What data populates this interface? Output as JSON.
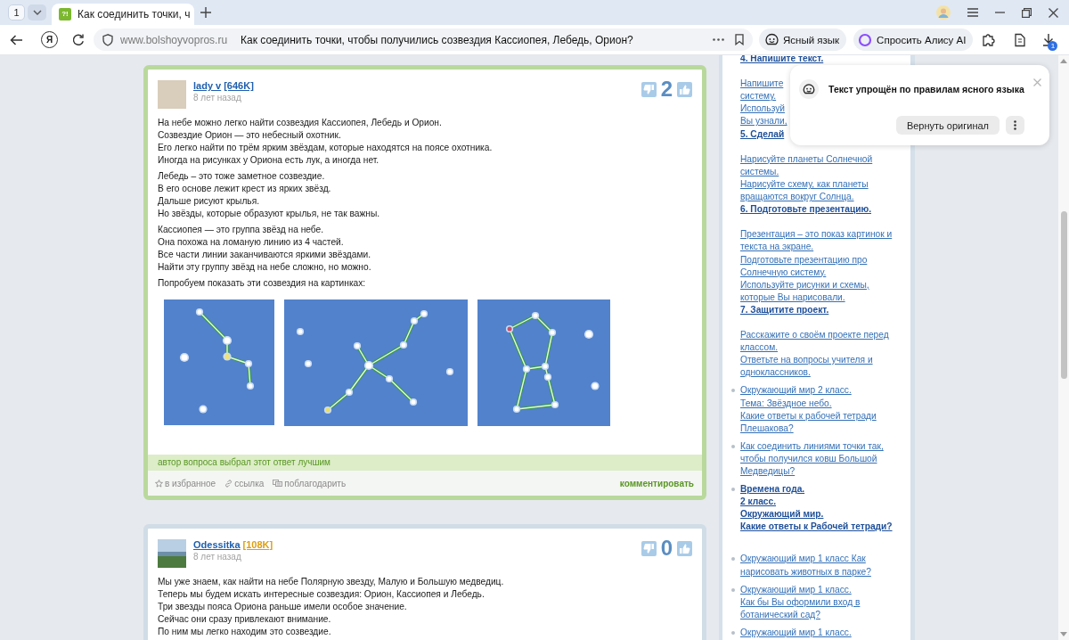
{
  "browser": {
    "tab_counter": "1",
    "tabs": [
      {
        "favicon": "?!",
        "title": "Как соединить точки, ч",
        "selected": true
      }
    ],
    "home": "Я",
    "url": "www.bolshoyvopros.ru",
    "page_title": "Как соединить точки, чтобы получились созвездия Кассиопея, Лебедь, Орион?",
    "buttons": [
      {
        "kind": "clear-language",
        "label": "Ясный язык"
      },
      {
        "kind": "alice",
        "label": "Спросить Алису AI"
      }
    ],
    "downloads_badge": "1"
  },
  "answers": [
    {
      "best": true,
      "avatar": {
        "kind": "portrait"
      },
      "author": "lady v",
      "rating": {
        "text": "[646K]",
        "color": "#1f5fae"
      },
      "time": "8 лет назад",
      "votes": "2",
      "paragraphs": [
        [
          "На небе можно легко найти созвездия Кассиопея, Лебедь и Орион.",
          "Созвездие Орион — это небесный охотник.",
          "Его легко найти по трём ярким звёздам, которые находятся на поясе охотника.",
          "Иногда на рисунках у Ориона есть лук, а иногда нет."
        ],
        [
          "Лебедь – это тоже заметное созвездие.",
          "В его основе лежит крест из ярких звёзд.",
          "Дальше рисуют крылья.",
          "Но звёзды, которые образуют крылья, не так важны."
        ],
        [
          "Кассиопея — это группа звёзд на небе.",
          "Она похожа на ломаную линию из 4 частей.",
          "Все части линии заканчиваются яркими звёздами.",
          "Найти эту группу звёзд на небе сложно, но можно."
        ],
        [
          "Попробуем показать эти созвездия на картинках:"
        ]
      ],
      "figures": [
        {
          "kind": "cassiopeia"
        },
        {
          "kind": "cygnus"
        },
        {
          "kind": "orion"
        }
      ],
      "best_note": "автор вопроса выбрал этот ответ лучшим",
      "actions": [
        {
          "kind": "favorite",
          "label": "в избранное"
        },
        {
          "kind": "link",
          "label": "ссылка"
        },
        {
          "kind": "thanks",
          "label": "поблагодарить"
        }
      ],
      "comment": "комментировать"
    },
    {
      "best": false,
      "avatar": {
        "kind": "landscape"
      },
      "author": "Odessitka",
      "rating": {
        "text": "[108K]",
        "color": "#dd9f12"
      },
      "time": "8 лет назад",
      "votes": "0",
      "paragraphs": [
        [
          "Мы уже знаем, как найти на небе Полярную звезду, Малую и Большую медведиц.",
          "Теперь мы будем искать интересные созвездия: Орион, Кассиопея и Лебедь.",
          "Три звезды пояса Ориона раньше имели особое значение.",
          "Сейчас они сразу привлекают внимание.",
          "По ним мы легко находим это созвездие."
        ]
      ]
    }
  ],
  "sidebar": {
    "items": [
      {
        "kind": "continued",
        "paragraphs": [
          [
            {
              "text": "4. Напишите текст.",
              "bold": true
            }
          ],
          [
            {
              "text": "Напишите",
              "bold": false
            },
            {
              "text": "систему.",
              "bold": false
            },
            {
              "text": "Используй",
              "bold": false
            },
            {
              "text": "Вы узнали,",
              "bold": false
            },
            {
              "text": "5. Сделай",
              "bold": true
            }
          ],
          [
            {
              "text": "Нарисуйте планеты Солнечной",
              "bold": false
            },
            {
              "text": "системы.",
              "bold": false
            },
            {
              "text": "Нарисуйте схему, как планеты",
              "bold": false
            },
            {
              "text": "вращаются вокруг Солнца.",
              "bold": false
            },
            {
              "text": "6. Подготовьте презентацию.",
              "bold": true
            }
          ],
          [
            {
              "text": "Презентация – это показ картинок и",
              "bold": false
            },
            {
              "text": "текста на экране.",
              "bold": false
            },
            {
              "text": "Подготовьте презентацию про",
              "bold": false
            },
            {
              "text": "Солнечную систему.",
              "bold": false
            },
            {
              "text": "Используйте рисунки и схемы,",
              "bold": false
            },
            {
              "text": "которые Вы нарисовали.",
              "bold": false
            },
            {
              "text": "7. Защитите проект.",
              "bold": true
            }
          ],
          [
            {
              "text": "Расскажите о своём проекте перед",
              "bold": false
            },
            {
              "text": "классом.",
              "bold": false
            },
            {
              "text": "Ответьте на вопросы учителя и",
              "bold": false
            },
            {
              "text": "одноклассников.",
              "bold": false
            }
          ]
        ]
      },
      {
        "kind": "bullet",
        "paragraphs": [
          [
            {
              "text": "Окружающий мир 2 класс.",
              "bold": false
            },
            {
              "text": "Тема: Звёздное небо.",
              "bold": false
            },
            {
              "text": "Какие ответы к рабочей тетради",
              "bold": false
            },
            {
              "text": "Плешакова?",
              "bold": false
            }
          ]
        ]
      },
      {
        "kind": "bullet",
        "paragraphs": [
          [
            {
              "text": "Как соединить линиями точки так,",
              "bold": false
            },
            {
              "text": "чтобы получился ковш Большой",
              "bold": false
            },
            {
              "text": "Медведицы?",
              "bold": false
            }
          ]
        ]
      },
      {
        "kind": "bullet-gap",
        "paragraphs": [
          [
            {
              "text": "Времена года.",
              "bold": true
            },
            {
              "text": "2 класс.",
              "bold": true
            },
            {
              "text": "Окружающий мир.",
              "bold": true
            },
            {
              "text": "Какие ответы к Рабочей тетради?",
              "bold": true
            }
          ]
        ]
      },
      {
        "kind": "bullet",
        "paragraphs": [
          [
            {
              "text": "Окружающий мир 1 класс Как",
              "bold": false
            },
            {
              "text": "нарисовать животных в парке?",
              "bold": false
            }
          ]
        ]
      },
      {
        "kind": "bullet",
        "paragraphs": [
          [
            {
              "text": "Окружающий мир 1 класс.",
              "bold": false
            },
            {
              "text": "Как бы Вы оформили вход в",
              "bold": false
            },
            {
              "text": "ботанический сад?",
              "bold": false
            }
          ]
        ]
      },
      {
        "kind": "bullet",
        "paragraphs": [
          [
            {
              "text": "Окружающий мир 1 класс.",
              "bold": false
            }
          ]
        ]
      }
    ]
  },
  "popup": {
    "title": "Текст упрощён по правилам ясного языка",
    "button": "Вернуть оригинал"
  }
}
